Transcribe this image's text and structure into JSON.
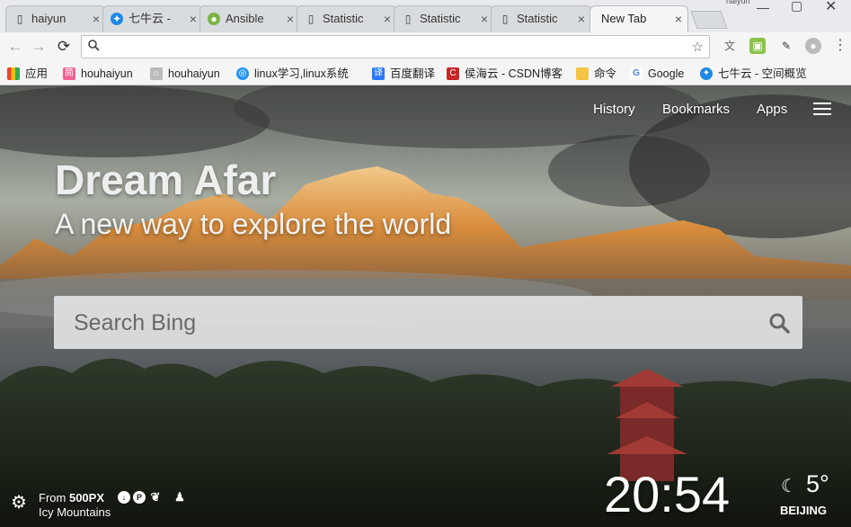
{
  "tabs": [
    {
      "title": "haiyun",
      "icon": "document-icon"
    },
    {
      "title": "七牛云 -",
      "icon": "qiniu-icon"
    },
    {
      "title": "Ansible",
      "icon": "ansible-icon"
    },
    {
      "title": "Statistic",
      "icon": "document-icon"
    },
    {
      "title": "Statistic",
      "icon": "document-icon"
    },
    {
      "title": "Statistic",
      "icon": "document-icon"
    },
    {
      "title": "New Tab",
      "icon": "none"
    }
  ],
  "window": {
    "corner_text": "haiyun"
  },
  "toolbar": {
    "address_value": "",
    "nav": {
      "back": "←",
      "forward": "→",
      "reload": "⟳"
    }
  },
  "bookmarks": [
    {
      "label": "应用",
      "icon": "apps-grid-icon",
      "color": "#e94235"
    },
    {
      "label": "houhaiyun",
      "icon": "jianshu-icon",
      "color": "#f06292"
    },
    {
      "label": "houhaiyun",
      "icon": "cnblogs-icon",
      "color": "#888888"
    },
    {
      "label": "linux学习,linux系统",
      "icon": "linux-site-icon",
      "color": "#2196f3"
    },
    {
      "label": "百度翻译",
      "icon": "baidu-translate-icon",
      "color": "#2979ff"
    },
    {
      "label": "侯海云 - CSDN博客",
      "icon": "csdn-icon",
      "color": "#c62828"
    },
    {
      "label": "命令",
      "icon": "folder-icon",
      "color": "#f4c542"
    },
    {
      "label": "Google",
      "icon": "google-icon",
      "color": "#4285f4"
    },
    {
      "label": "七牛云 - 空间概览",
      "icon": "qiniu-icon",
      "color": "#1e88e5"
    }
  ],
  "page": {
    "nav": {
      "history": "History",
      "bookmarks": "Bookmarks",
      "apps": "Apps"
    },
    "brand": "Dream Afar",
    "tagline": "A new way to explore the world",
    "search_placeholder": "Search Bing",
    "credit_from": "From",
    "credit_source": "500PX",
    "photo_title": "Icy Mountains",
    "clock": "20:54",
    "temperature": "5°",
    "city": "BEIJING"
  }
}
